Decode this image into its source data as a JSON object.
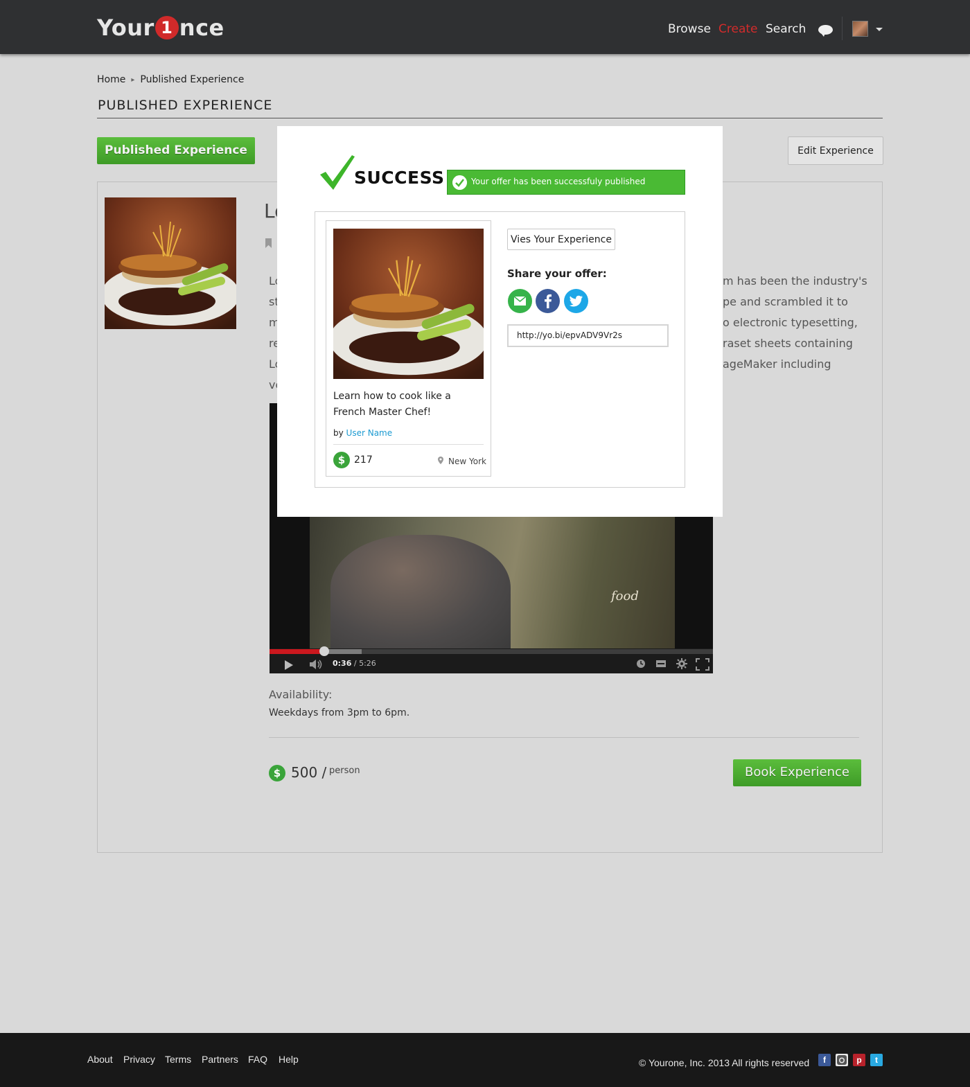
{
  "header": {
    "logo_left": "Your",
    "logo_one": "1",
    "logo_right": "nce",
    "nav": {
      "browse": "Browse",
      "create": "Create",
      "search": "Search"
    }
  },
  "breadcrumb": {
    "home": "Home",
    "current": "Published Experience"
  },
  "page_title": "PUBLISHED EXPERIENCE",
  "buttons": {
    "published": "Published Experience",
    "edit": "Edit Experience",
    "book": "Book Experience"
  },
  "panel": {
    "title_partial": "Lo",
    "left_fragments": [
      "Lo",
      "st",
      "m",
      "re",
      "Lo",
      "ve"
    ],
    "right_fragments": [
      "m has been the industry's",
      "pe and scrambled it to",
      "o electronic typesetting,",
      "raset sheets containing",
      "ageMaker including"
    ]
  },
  "video": {
    "current_time": "0:36",
    "duration": "/ 5:26",
    "watermark": "food",
    "progress_fraction": 0.12
  },
  "availability": {
    "label": "Availability:",
    "value": "Weekdays from 3pm to 6pm."
  },
  "pricing": {
    "currency_symbol": "$",
    "amount": "500 /",
    "unit": "person"
  },
  "modal": {
    "success_title": "SUCCESS!",
    "success_message": "Your offer has been successfuly published",
    "card": {
      "title": "Learn how to cook like a French Master Chef!",
      "by_prefix": "by",
      "author": "User Name",
      "count": "217",
      "city": "New York"
    },
    "view_button": "Vies Your Experience",
    "share_label": "Share your offer:",
    "share_icons": [
      "email-icon",
      "facebook-icon",
      "twitter-icon"
    ],
    "share_url": "http://yo.bi/epvADV9Vr2s"
  },
  "footer": {
    "links": [
      "About",
      "Privacy",
      "Terms",
      "Partners",
      "FAQ",
      "Help"
    ],
    "copyright": "© Yourone, Inc. 2013 All rights reserved",
    "social_icons": [
      "facebook-icon",
      "instagram-icon",
      "pinterest-icon",
      "twitter-icon"
    ]
  },
  "colors": {
    "accent_red": "#d32b2b",
    "success_green": "#4aba34",
    "button_green": "#3e9b27",
    "link_blue": "#1b9ad1",
    "header_bg": "#2f3032"
  }
}
